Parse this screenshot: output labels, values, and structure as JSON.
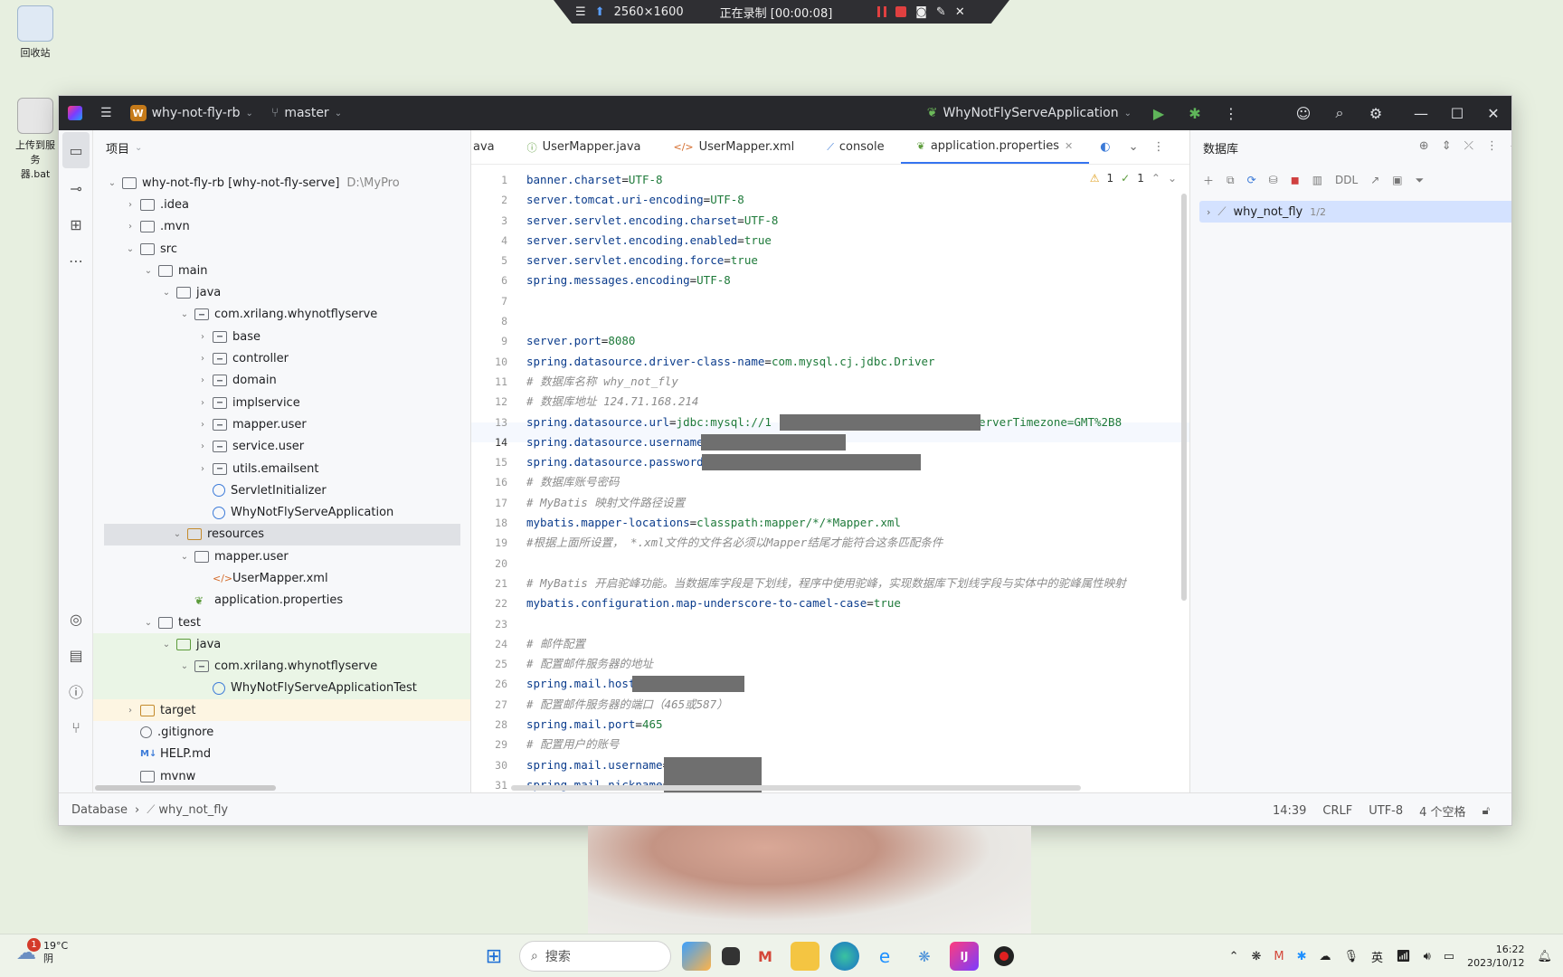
{
  "desktop": {
    "icons": [
      {
        "label": "回收站"
      },
      {
        "label": "上传到服务\n器.bat"
      }
    ]
  },
  "recorder": {
    "resolution": "2560×1600",
    "status": "正在录制 [00:00:08]"
  },
  "titlebar": {
    "project_badge": "W",
    "project_name": "why-not-fly-rb",
    "branch": "master",
    "run_config": "WhyNotFlyServeApplication"
  },
  "project_panel": {
    "title": "项目",
    "rows": [
      {
        "label": "why-not-fly-rb [why-not-fly-serve]",
        "extra": "D:\\MyPro"
      },
      {
        "label": ".idea"
      },
      {
        "label": ".mvn"
      },
      {
        "label": "src"
      },
      {
        "label": "main"
      },
      {
        "label": "java"
      },
      {
        "label": "com.xrilang.whynotflyserve"
      },
      {
        "label": "base"
      },
      {
        "label": "controller"
      },
      {
        "label": "domain"
      },
      {
        "label": "implservice"
      },
      {
        "label": "mapper.user"
      },
      {
        "label": "service.user"
      },
      {
        "label": "utils.emailsent"
      },
      {
        "label": "ServletInitializer"
      },
      {
        "label": "WhyNotFlyServeApplication"
      },
      {
        "label": "resources"
      },
      {
        "label": "mapper.user"
      },
      {
        "label": "UserMapper.xml"
      },
      {
        "label": "application.properties"
      },
      {
        "label": "test"
      },
      {
        "label": "java"
      },
      {
        "label": "com.xrilang.whynotflyserve"
      },
      {
        "label": "WhyNotFlyServeApplicationTest"
      },
      {
        "label": "target"
      },
      {
        "label": ".gitignore"
      },
      {
        "label": "HELP.md"
      },
      {
        "label": "mvnw"
      }
    ]
  },
  "editor": {
    "tabs": [
      {
        "label": "ava"
      },
      {
        "label": "UserMapper.java"
      },
      {
        "label": "UserMapper.xml"
      },
      {
        "label": "console"
      },
      {
        "label": "application.properties"
      }
    ],
    "inspections": {
      "warnings": "1",
      "ok": "1"
    },
    "line_numbers": [
      "1",
      "2",
      "3",
      "4",
      "5",
      "6",
      "7",
      "8",
      "9",
      "10",
      "11",
      "12",
      "13",
      "14",
      "15",
      "16",
      "17",
      "18",
      "19",
      "20",
      "21",
      "22",
      "23",
      "24",
      "25",
      "26",
      "27",
      "28",
      "29",
      "30",
      "31"
    ],
    "lines": [
      {
        "k": "banner.charset",
        "v": "UTF-8"
      },
      {
        "k": "server.tomcat.uri-encoding",
        "v": "UTF-8"
      },
      {
        "k": "server.servlet.encoding.charset",
        "v": "UTF-8"
      },
      {
        "k": "server.servlet.encoding.enabled",
        "v": "true"
      },
      {
        "k": "server.servlet.encoding.force",
        "v": "true"
      },
      {
        "k": "spring.messages.encoding",
        "v": "UTF-8"
      },
      {
        "c": ""
      },
      {
        "c": ""
      },
      {
        "k": "server.port",
        "v": "8080"
      },
      {
        "k": "spring.datasource.driver-class-name",
        "v": "com.mysql.cj.jdbc.Driver"
      },
      {
        "c": "# 数据库名称 why_not_fly"
      },
      {
        "c": "# 数据库地址 124.71.168.214"
      },
      {
        "k": "spring.datasource.url",
        "v": "jdbc:mysql://1",
        "tail": "?serverTimezone=GMT%2B8"
      },
      {
        "k": "spring.datasource.username",
        "v": ""
      },
      {
        "k": "spring.datasource.password",
        "v": ""
      },
      {
        "c": "# 数据库账号密码"
      },
      {
        "c": "# MyBatis 映射文件路径设置"
      },
      {
        "k": "mybatis.mapper-locations",
        "v": "classpath:mapper/*/*Mapper.xml"
      },
      {
        "c": "#根据上面所设置， *.xml文件的文件名必须以Mapper结尾才能符合这条匹配条件"
      },
      {
        "c": ""
      },
      {
        "c": "# MyBatis 开启驼峰功能。当数据库字段是下划线，程序中使用驼峰，实现数据库下划线字段与实体中的驼峰属性映射"
      },
      {
        "k": "mybatis.configuration.map-underscore-to-camel-case",
        "v": "true"
      },
      {
        "c": ""
      },
      {
        "c": "# 邮件配置"
      },
      {
        "c": "# 配置邮件服务器的地址"
      },
      {
        "k": "spring.mail.host",
        "v": ""
      },
      {
        "c": "# 配置邮件服务器的端口（465或587）"
      },
      {
        "k": "spring.mail.port",
        "v": "465"
      },
      {
        "c": "# 配置用户的账号"
      },
      {
        "k": "spring.mail.username",
        "v": ""
      },
      {
        "k": "spring.mail.nickname",
        "v": ""
      }
    ]
  },
  "database_panel": {
    "title": "数据库",
    "toolbar_ddl": "DDL",
    "db_name": "why_not_fly",
    "db_count": "1/2"
  },
  "statusbar": {
    "breadcrumb_root": "Database",
    "breadcrumb_item": "why_not_fly",
    "position": "14:39",
    "line_sep": "CRLF",
    "encoding": "UTF-8",
    "indent": "4 个空格"
  },
  "taskbar": {
    "weather_temp": "19°C",
    "weather_desc": "阴",
    "weather_badge": "1",
    "search_placeholder": "搜索",
    "time": "16:22",
    "date": "2023/10/12",
    "ime": "英"
  },
  "colors": {
    "accent": "#3574f0",
    "titlebar": "#27282c",
    "key": "#0b3c8c",
    "value": "#1e7a3a",
    "comment": "#8c8c8c"
  }
}
